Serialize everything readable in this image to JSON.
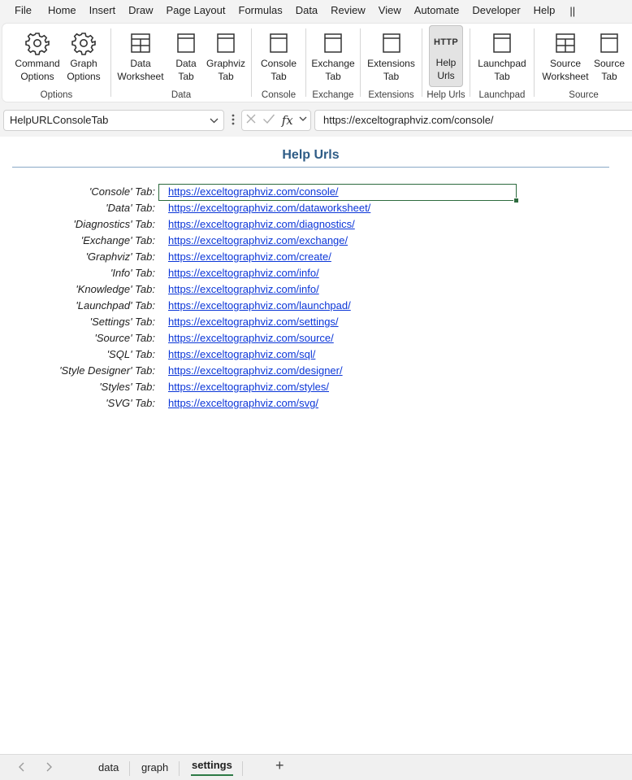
{
  "menu": [
    "File",
    "Home",
    "Insert",
    "Draw",
    "Page Layout",
    "Formulas",
    "Data",
    "Review",
    "View",
    "Automate",
    "Developer",
    "Help"
  ],
  "menu_more": "||",
  "ribbon": {
    "groups": [
      {
        "label": "Options",
        "buttons": [
          {
            "label": "Command Options",
            "icon": "gear-icon"
          },
          {
            "label": "Graph Options",
            "icon": "gear-icon"
          }
        ]
      },
      {
        "label": "Data",
        "buttons": [
          {
            "label": "Data Worksheet",
            "icon": "worksheet-grid-icon"
          },
          {
            "label": "Data Tab",
            "icon": "window-icon"
          },
          {
            "label": "Graphviz Tab",
            "icon": "window-icon"
          }
        ]
      },
      {
        "label": "Console",
        "buttons": [
          {
            "label": "Console Tab",
            "icon": "window-icon"
          }
        ]
      },
      {
        "label": "Exchange",
        "buttons": [
          {
            "label": "Exchange Tab",
            "icon": "window-icon"
          }
        ]
      },
      {
        "label": "Extensions",
        "buttons": [
          {
            "label": "Extensions Tab",
            "icon": "window-icon"
          }
        ]
      },
      {
        "label": "Help Urls",
        "buttons": [
          {
            "label": "Help Urls",
            "icon": "http-icon",
            "icon_text": "HTTP"
          }
        ]
      },
      {
        "label": "Launchpad",
        "buttons": [
          {
            "label": "Launchpad Tab",
            "icon": "window-icon"
          }
        ]
      },
      {
        "label": "Source",
        "buttons": [
          {
            "label": "Source Worksheet",
            "icon": "worksheet-grid-icon"
          },
          {
            "label": "Source Tab",
            "icon": "window-icon"
          }
        ]
      }
    ]
  },
  "formula_bar": {
    "name_box": "HelpURLConsoleTab",
    "fx": "fx",
    "formula": "https://exceltographviz.com/console/"
  },
  "sheet": {
    "title": "Help Urls",
    "rows": [
      {
        "label": "'Console' Tab:",
        "url": "https://exceltographviz.com/console/"
      },
      {
        "label": "'Data' Tab:",
        "url": "https://exceltographviz.com/dataworksheet/"
      },
      {
        "label": "'Diagnostics' Tab:",
        "url": "https://exceltographviz.com/diagnostics/"
      },
      {
        "label": "'Exchange' Tab:",
        "url": "https://exceltographviz.com/exchange/"
      },
      {
        "label": "'Graphviz' Tab:",
        "url": "https://exceltographviz.com/create/"
      },
      {
        "label": "'Info' Tab:",
        "url": "https://exceltographviz.com/info/"
      },
      {
        "label": "'Knowledge' Tab:",
        "url": "https://exceltographviz.com/info/"
      },
      {
        "label": "'Launchpad' Tab:",
        "url": "https://exceltographviz.com/launchpad/"
      },
      {
        "label": "'Settings' Tab:",
        "url": "https://exceltographviz.com/settings/"
      },
      {
        "label": "'Source' Tab:",
        "url": "https://exceltographviz.com/source/"
      },
      {
        "label": "'SQL' Tab:",
        "url": "https://exceltographviz.com/sql/"
      },
      {
        "label": "'Style Designer' Tab:",
        "url": "https://exceltographviz.com/designer/"
      },
      {
        "label": "'Styles' Tab:",
        "url": "https://exceltographviz.com/styles/"
      },
      {
        "label": "'SVG' Tab:",
        "url": "https://exceltographviz.com/svg/"
      }
    ]
  },
  "sheet_tabs": {
    "tabs": [
      "data",
      "graph",
      "settings"
    ],
    "active": "settings",
    "add": "+"
  },
  "colors": {
    "accent": "#2d7a46",
    "link": "#0b36d8",
    "title": "#2e5c86"
  }
}
